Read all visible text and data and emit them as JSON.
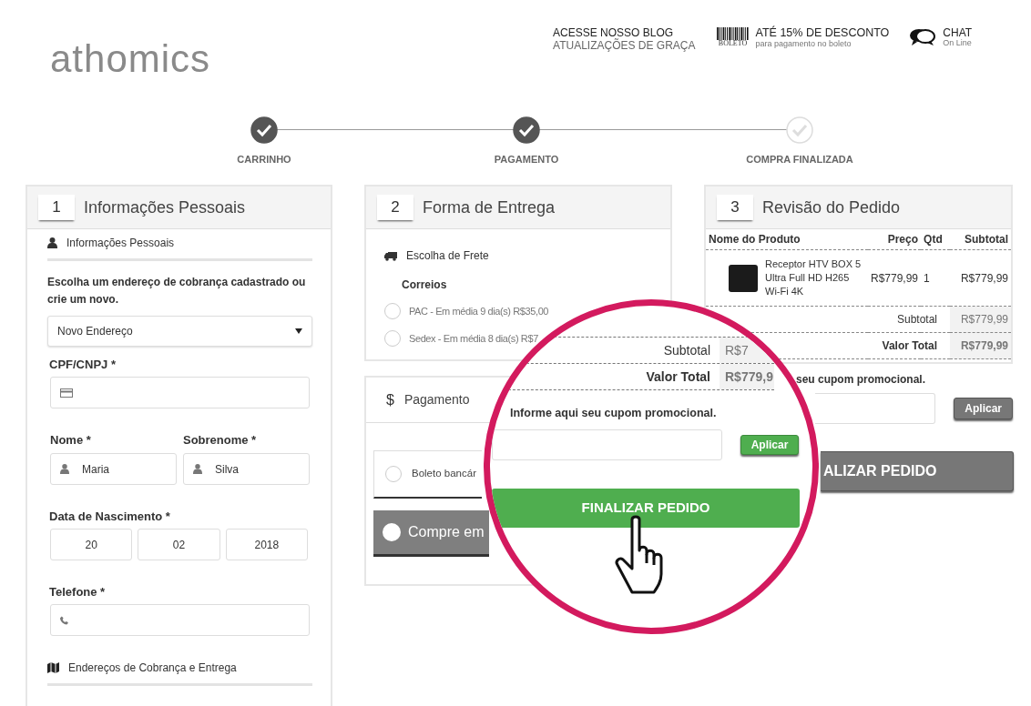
{
  "logo": {
    "text": "athomics"
  },
  "header_links": [
    {
      "kind": "blog",
      "title": "ACESSE NOSSO BLOG",
      "subtitle": "ATUALIZAÇÕES DE GRAÇA"
    },
    {
      "kind": "boleto",
      "icon_text": "BOLETO",
      "title": "ATÉ 15% DE DESCONTO",
      "subtitle": "para pagamento no boleto"
    },
    {
      "kind": "chat",
      "title": "CHAT",
      "subtitle": "On Line"
    }
  ],
  "steps": [
    {
      "label": "CARRINHO",
      "done": true
    },
    {
      "label": "PAGAMENTO",
      "done": true
    },
    {
      "label": "COMPRA FINALIZADA",
      "done": false
    }
  ],
  "personal": {
    "number": "1",
    "title": "Informações Pessoais",
    "section": "Informações Pessoais",
    "address_prompt": "Escolha um endereço de cobrança cadastrado ou crie um novo.",
    "address_select": "Novo Endereço",
    "cpf_label": "CPF/CNPJ *",
    "name_label": "Nome *",
    "name_value": "Maria",
    "surname_label": "Sobrenome *",
    "surname_value": "Silva",
    "birth_label": "Data de Nascimento *",
    "birth": [
      "20",
      "02",
      "2018"
    ],
    "phone_label": "Telefone *",
    "addresses_section": "Endereços de Cobrança e Entrega"
  },
  "delivery": {
    "number": "2",
    "title": "Forma de Entrega",
    "section": "Escolha de Frete",
    "carrier": "Correios",
    "options": [
      {
        "label": "PAC - Em média 9 dia(s) R$35,00",
        "selected": false
      },
      {
        "label": "Sedex - Em média 8 dia(s) R$7",
        "selected": false
      }
    ]
  },
  "payment": {
    "icon_char": "$",
    "title": "Pagamento",
    "options": [
      {
        "kind": "radio",
        "label": "Boleto bancár",
        "selected": false
      },
      {
        "kind": "banner",
        "label": "Compre em",
        "selected": false
      }
    ]
  },
  "review": {
    "number": "3",
    "title": "Revisão do Pedido",
    "columns": [
      "Nome do Produto",
      "Preço",
      "Qtd",
      "Subtotal"
    ],
    "items": [
      {
        "name": "Receptor HTV BOX 5 Ultra Full HD H265 Wi-Fi 4K",
        "price": "R$779,99",
        "qty": "1",
        "subtotal": "R$779,99"
      }
    ],
    "totals": [
      {
        "label": "Subtotal",
        "value": "R$779,99",
        "emphasis": false
      },
      {
        "label": "Valor Total",
        "value": "R$779,99",
        "emphasis": true
      }
    ]
  },
  "coupon": {
    "label": "seu cupom promocional.",
    "button": "Aplicar"
  },
  "finish_button": "ALIZAR PEDIDO",
  "magnifier": {
    "totals": [
      {
        "label": "Subtotal",
        "value": "R$7",
        "emphasis": false
      },
      {
        "label": "Valor Total",
        "value": "R$779,9",
        "emphasis": true
      }
    ],
    "coupon_label": "Informe aqui seu cupom promocional.",
    "coupon_button": "Aplicar",
    "finish_button": "FINALIZAR PEDIDO"
  }
}
